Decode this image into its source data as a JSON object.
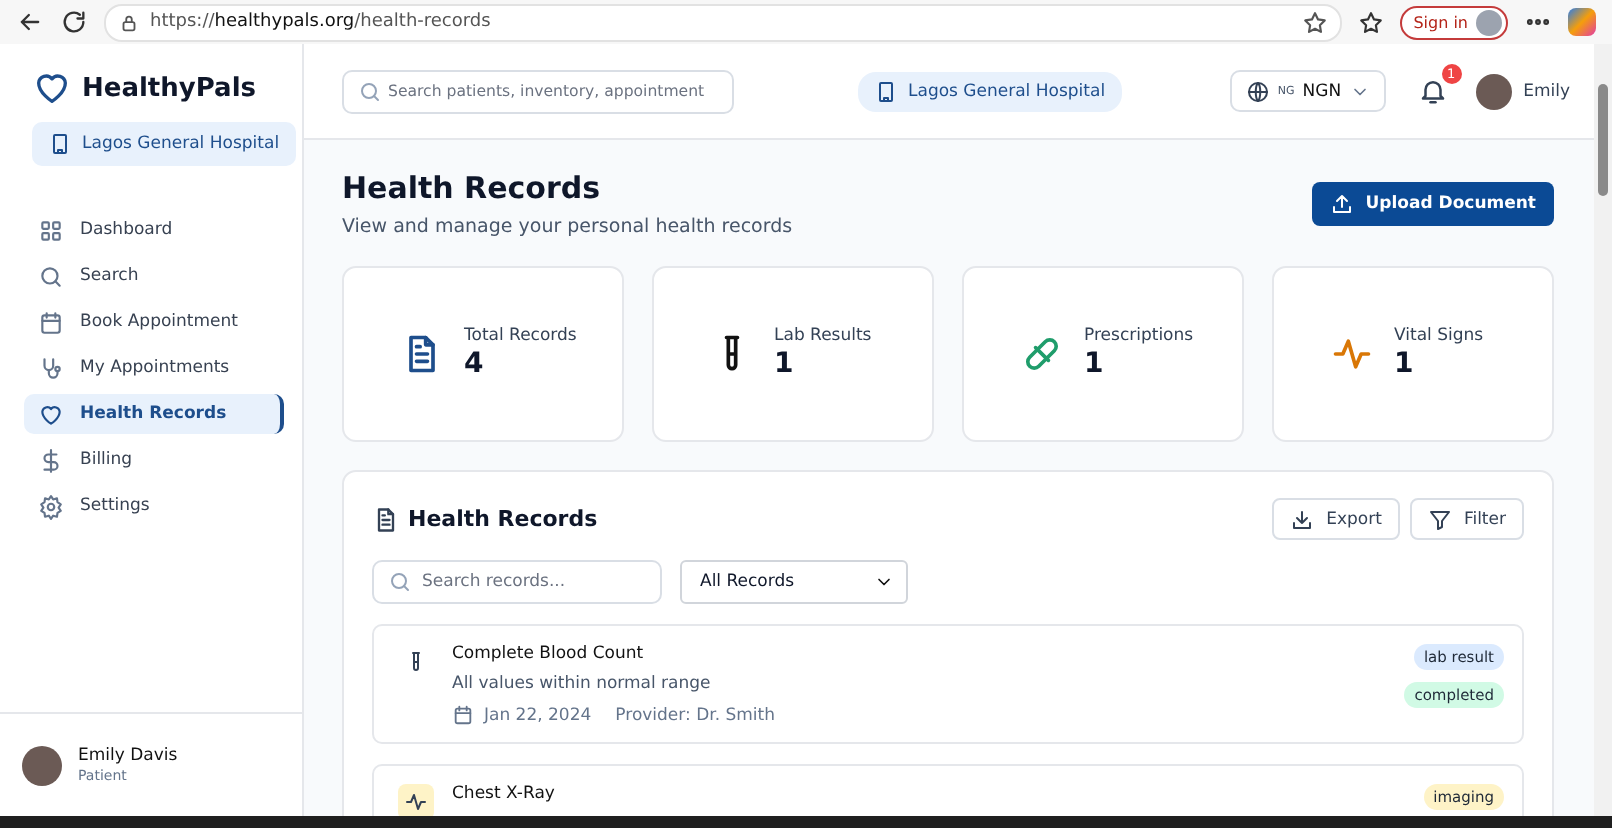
{
  "browser": {
    "url": "https://**healthypals.org**/health-records",
    "sign_in": "Sign in"
  },
  "sidebar": {
    "brand": "HealthyPals",
    "hospital": "Lagos General Hospital",
    "items": [
      {
        "label": "Dashboard",
        "selected": false
      },
      {
        "label": "Search",
        "selected": false
      },
      {
        "label": "Book Appointment",
        "selected": false
      },
      {
        "label": "My Appointments",
        "selected": false
      },
      {
        "label": "Health Records",
        "selected": true
      },
      {
        "label": "Billing",
        "selected": false
      },
      {
        "label": "Settings",
        "selected": false
      }
    ],
    "user": {
      "name": "Emily Davis",
      "role": "Patient"
    }
  },
  "header": {
    "search": {
      "placeholder": "Search patients, inventory, appointment"
    },
    "hospital": "Lagos General Hospital",
    "currency": {
      "flag": "NG",
      "code": "NGN"
    },
    "notifications": "1",
    "user": "Emily"
  },
  "page": {
    "title": "Health Records",
    "subtitle": "View and manage your personal health records",
    "upload": "Upload Document"
  },
  "stats": [
    {
      "kind": "total",
      "label": "Total Records",
      "value": "4"
    },
    {
      "kind": "lab",
      "label": "Lab Results",
      "value": "1"
    },
    {
      "kind": "prescription",
      "label": "Prescriptions",
      "value": "1"
    },
    {
      "kind": "vital",
      "label": "Vital Signs",
      "value": "1"
    }
  ],
  "records_panel": {
    "title": "Health Records",
    "export": "Export",
    "filter": "Filter",
    "search": {
      "placeholder": "Search records..."
    },
    "type_select": "All Records",
    "records": [
      {
        "kind": "lab",
        "title": "Complete Blood Count",
        "description": "All values within normal range",
        "date": "Jan 22, 2024",
        "provider": "Provider: Dr. Smith",
        "tags": [
          {
            "label": "lab result",
            "color": "#dbeafe"
          },
          {
            "label": "completed",
            "color": "#d1fae5"
          }
        ]
      },
      {
        "kind": "imaging",
        "title": "Chest X-Ray",
        "tags": [
          {
            "label": "imaging",
            "color": "#fef3c7"
          }
        ]
      }
    ]
  }
}
